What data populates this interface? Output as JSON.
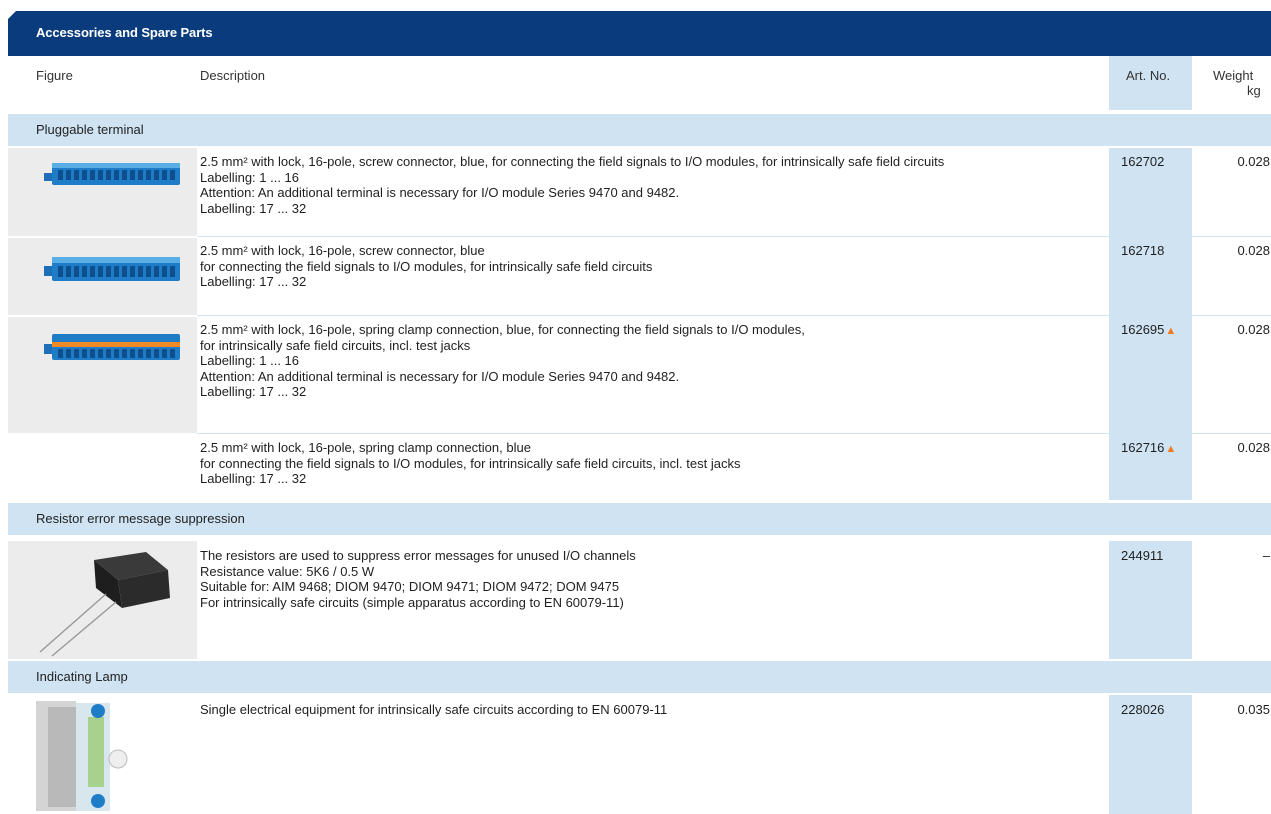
{
  "title": "Accessories and Spare Parts",
  "header": {
    "figure": "Figure",
    "description": "Description",
    "art_no": "Art. No.",
    "weight": "Weight",
    "weight_unit": "kg"
  },
  "groups": [
    {
      "label": "Pluggable terminal"
    },
    {
      "label": "Resistor error message suppression"
    },
    {
      "label": "Indicating Lamp"
    }
  ],
  "rows": [
    {
      "lines": [
        "2.5 mm² with lock, 16-pole, screw connector, blue, for connecting the field signals to I/O modules, for intrinsically safe field circuits",
        "Labelling: 1 ... 16",
        "Attention: An additional terminal is necessary for I/O module Series 9470 and 9482.",
        "Labelling: 17 ... 32"
      ],
      "art": "162702",
      "weight": "0.028",
      "flag": ""
    },
    {
      "lines": [
        "2.5 mm² with lock, 16-pole, screw connector, blue",
        "for connecting the field signals to I/O modules, for intrinsically safe field circuits",
        "Labelling: 17 ... 32"
      ],
      "art": "162718",
      "weight": "0.028",
      "flag": ""
    },
    {
      "lines": [
        "2.5 mm² with lock, 16-pole, spring clamp connection, blue, for connecting the field signals to I/O modules,",
        "for intrinsically safe field circuits, incl. test jacks",
        "Labelling: 1 ... 16",
        "Attention: An additional terminal is necessary for I/O module Series 9470 and 9482.",
        "Labelling: 17 ... 32"
      ],
      "art": "162695",
      "weight": "0.028",
      "flag": "▲"
    },
    {
      "lines": [
        "2.5 mm² with lock, 16-pole, spring clamp connection, blue",
        "for connecting the field signals to I/O modules, for intrinsically safe field circuits, incl. test jacks",
        "Labelling: 17 ... 32"
      ],
      "art": "162716",
      "weight": "0.028",
      "flag": "▲"
    },
    {
      "lines": [
        "The resistors are used to suppress error messages for unused I/O channels",
        "Resistance value: 5K6 / 0.5 W",
        "Suitable for: AIM 9468; DIOM 9470; DIOM 9471; DIOM 9472; DOM 9475",
        "For intrinsically safe circuits (simple apparatus according to EN 60079-11)"
      ],
      "art": "244911",
      "weight": "–",
      "flag": ""
    },
    {
      "lines": [
        "Single electrical equipment for intrinsically safe circuits according to EN 60079-11"
      ],
      "art": "228026",
      "weight": "0.035",
      "flag": ""
    }
  ],
  "colors": {
    "title_bar": "#0a3c7d",
    "highlight": "#cfe3f2",
    "figure_bg": "#ececec",
    "flag": "#f07a20"
  },
  "icons": [
    "terminal-screw-image",
    "terminal-spring-image",
    "resistor-image",
    "indicating-lamp-image",
    "warning-triangle-icon"
  ]
}
